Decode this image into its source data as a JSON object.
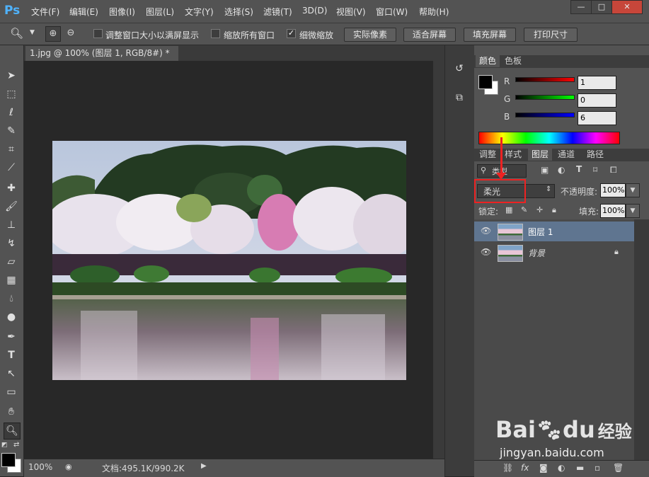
{
  "app": {
    "logo": "Ps"
  },
  "menu": [
    "文件(F)",
    "编辑(E)",
    "图像(I)",
    "图层(L)",
    "文字(Y)",
    "选择(S)",
    "滤镜(T)",
    "3D(D)",
    "视图(V)",
    "窗口(W)",
    "帮助(H)"
  ],
  "window_controls": {
    "minimize": "—",
    "maximize": "□",
    "close": "✕"
  },
  "options": {
    "resize_windows": "调整窗口大小以满屏显示",
    "zoom_all": "缩放所有窗口",
    "scrubby_zoom": "细微缩放",
    "actual_pixels": "实际像素",
    "fit_screen": "适合屏幕",
    "fill_screen": "填充屏幕",
    "print_size": "打印尺寸"
  },
  "document": {
    "tab_title": "1.jpg @ 100% (图层 1, RGB/8#) *",
    "tab_close": "×"
  },
  "status": {
    "zoom": "100%",
    "doc_size": "文档:495.1K/990.2K"
  },
  "color_panel": {
    "tabs": [
      "颜色",
      "色板"
    ],
    "r_label": "R",
    "r_value": "1",
    "g_label": "G",
    "g_value": "0",
    "b_label": "B",
    "b_value": "6"
  },
  "layers_panel": {
    "tabs": [
      "调整",
      "样式",
      "图层",
      "通道",
      "路径"
    ],
    "filter_kind": "类型",
    "blend_mode": "柔光",
    "opacity_label": "不透明度:",
    "opacity_value": "100%",
    "lock_label": "锁定:",
    "fill_label": "填充:",
    "fill_value": "100%",
    "layers": [
      {
        "name": "图层 1",
        "selected": true
      },
      {
        "name": "背景",
        "selected": false
      }
    ]
  },
  "watermark": {
    "brand": "Bai",
    "brand2": "du",
    "brand_cn": "经验",
    "url": "jingyan.baidu.com"
  }
}
